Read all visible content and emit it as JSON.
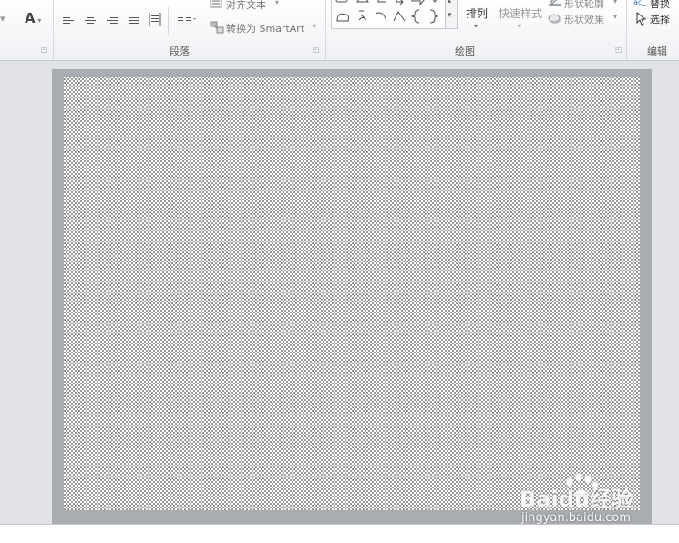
{
  "ribbon": {
    "font_glyph": "A",
    "align_text_label": "对齐文本",
    "convert_smartart_label": "转换为 SmartArt",
    "arrange_label": "排列",
    "quick_styles_label": "快速样式",
    "shape_outline_label": "形状轮廓",
    "shape_effects_label": "形状效果",
    "replace_label": "替换",
    "select_label": "选择"
  },
  "groups": {
    "paragraph": "段落",
    "drawing": "绘图",
    "editing": "编辑"
  },
  "watermark": {
    "logo": "Baidu经验",
    "url": "jingyan.baidu.com"
  },
  "colors": {
    "accent_blue": "#2e75b6",
    "slide_frame": "#a9acb0",
    "pattern_dots": "#9a9a9a"
  }
}
